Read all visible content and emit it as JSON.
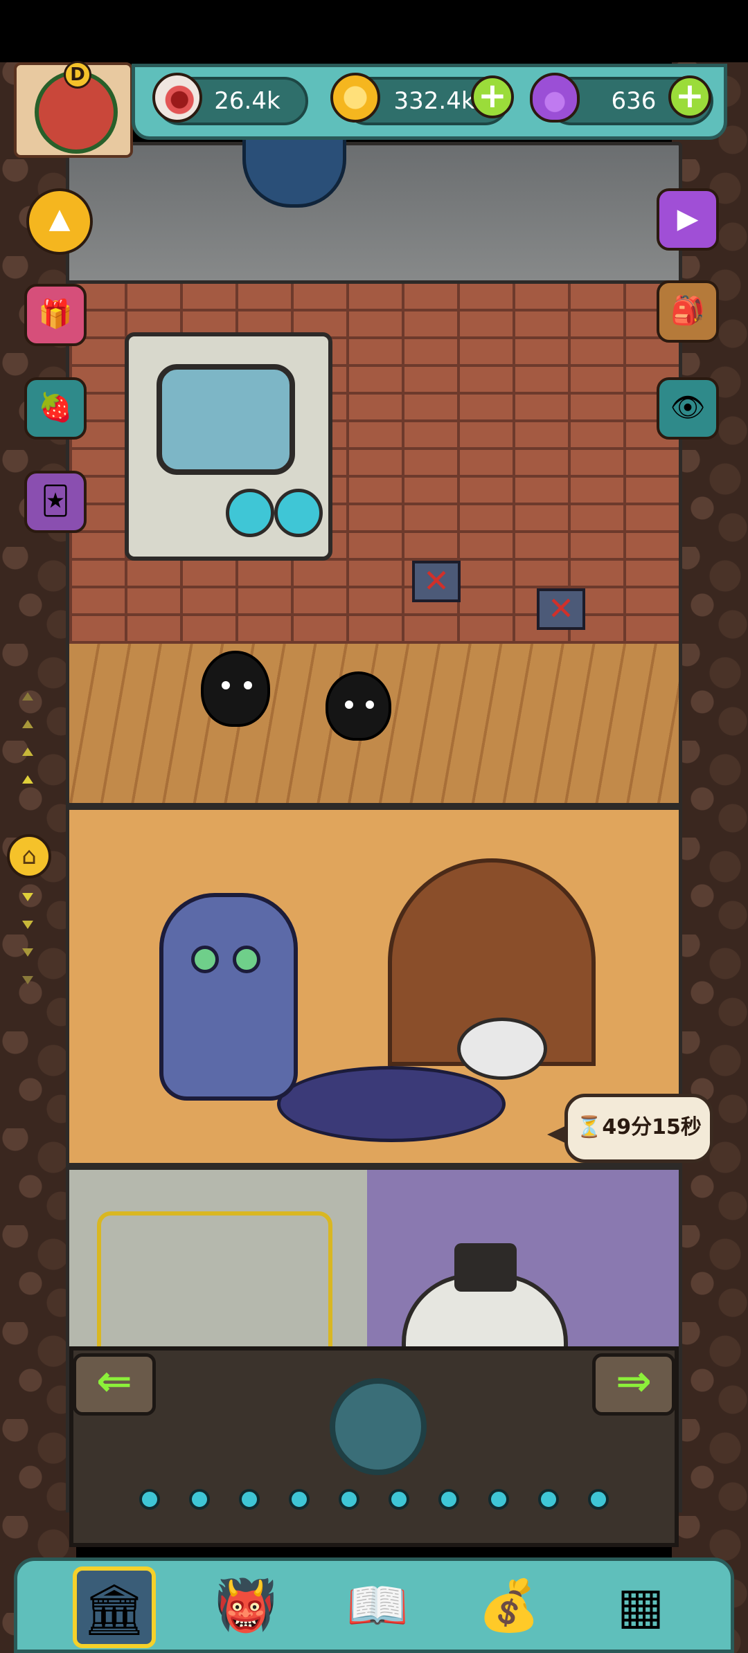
{
  "resources": {
    "eyeballs": {
      "icon": "eyeball-icon",
      "value": "26.4k"
    },
    "coins": {
      "icon": "gold-coin-icon",
      "value": "332.4k",
      "add_icon": "plus-icon"
    },
    "potions": {
      "icon": "purple-potion-icon",
      "value": "636",
      "add_icon": "plus-icon"
    }
  },
  "player": {
    "grade_badge": "D",
    "avatar_icon": "monster-avatar-icon"
  },
  "timer": {
    "label": "⏳49分15秒"
  },
  "side_left": [
    {
      "name": "up-arrow-icon"
    },
    {
      "name": "gift-box-icon"
    },
    {
      "name": "fruit-basket-icon"
    },
    {
      "name": "card-pack-icon"
    },
    {
      "name": "home-icon"
    }
  ],
  "side_right": [
    {
      "name": "video-ad-icon"
    },
    {
      "name": "backpack-icon"
    },
    {
      "name": "eyeball-cluster-icon"
    }
  ],
  "nav_arrows": {
    "left": "⇐",
    "right": "⇒"
  },
  "bottom_nav": [
    {
      "name": "tower-icon",
      "selected": true
    },
    {
      "name": "furnace-monster-icon"
    },
    {
      "name": "book-icon"
    },
    {
      "name": "money-bag-icon"
    },
    {
      "name": "grid-menu-icon"
    }
  ],
  "colors": {
    "hud_teal": "#5fbfbb",
    "plus_green": "#9bdc3a",
    "coin_gold": "#f5c22a",
    "potion_purple": "#9b4fd6",
    "led_cyan": "#3fc6d6"
  }
}
